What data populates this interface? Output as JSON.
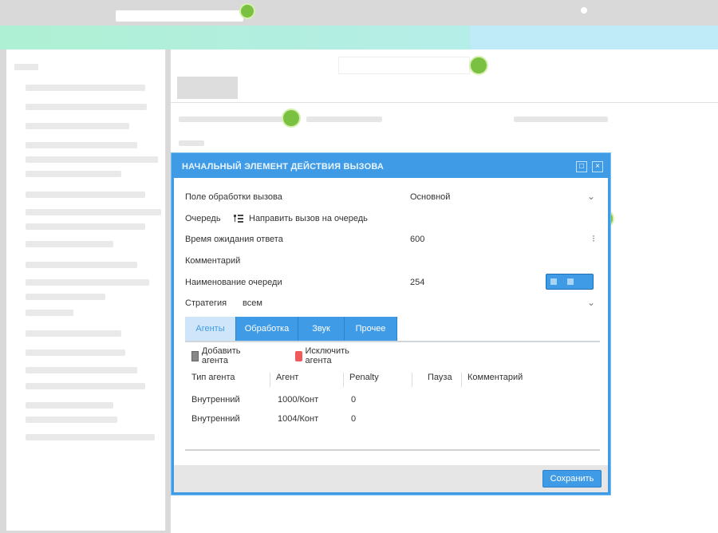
{
  "modal": {
    "title": "НАЧАЛЬНЫЙ ЭЛЕМЕНТ ДЕЙСТВИЯ ВЫЗОВА",
    "fields": [
      {
        "label": "Поле обработки вызова",
        "value": "Основной"
      },
      {
        "label": "Очередь",
        "value": "Направить вызов на очередь"
      },
      {
        "label": "Время ожидания ответа",
        "value": "600"
      },
      {
        "label": "Комментарий",
        "value": ""
      },
      {
        "label": "Наименование очереди",
        "value": "254"
      },
      {
        "label": "Стратегия",
        "value": "всем"
      }
    ],
    "tabs": [
      {
        "label": "Агенты"
      },
      {
        "label": "Обработка"
      },
      {
        "label": "Звук"
      },
      {
        "label": "Прочее"
      }
    ],
    "toolbar": {
      "add_label": "Добавить агента",
      "delete_label": "Исключить агента"
    },
    "grid": {
      "headers": [
        "Тип агента",
        "Агент",
        "Penalty",
        "Пауза",
        "Комментарий"
      ],
      "rows": [
        {
          "type": "Внутренний",
          "agent": "1000/Конт",
          "penalty": "0"
        },
        {
          "type": "Внутренний",
          "agent": "1004/Конт",
          "penalty": "0"
        }
      ]
    },
    "save_label": "Сохранить"
  },
  "colors": {
    "accent": "#3f9be6",
    "marker": "#7ac142",
    "danger": "#f05a5a"
  }
}
